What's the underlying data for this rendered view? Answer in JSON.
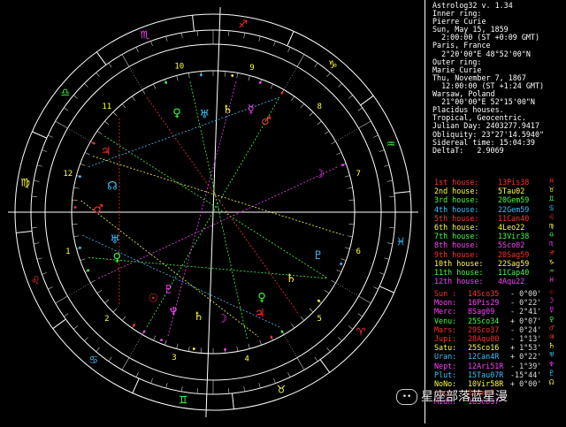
{
  "info_lines": [
    "Astrolog32 v. 1.34",
    "Inner ring:",
    "Pierre Curie",
    "Sun, May 15, 1859",
    "  2:00:00 (ST +0:09 GMT)",
    "Paris, France",
    "  2°20'00\"E 48°52'00\"N",
    "Outer ring:",
    "Marie Curie",
    "Thu, November 7, 1867",
    "  12:00:00 (ST +1:24 GMT)",
    "Warsaw, Poland",
    "  21°00'00\"E 52°15'00\"N",
    "Placidus houses.",
    "Tropical, Geocentric.",
    "Julian Day: 2403277.9417",
    "Obliquity: 23°27'14.5940\"",
    "Sidereal time: 15:04:39",
    "DeltaT:   2.9069"
  ],
  "houses": [
    {
      "label": "1st house:",
      "value": "13Pis38",
      "color": "#ff3030",
      "symbol": "♓"
    },
    {
      "label": "2nd house:",
      "value": "5Tau02",
      "color": "#ffff40",
      "symbol": "♉"
    },
    {
      "label": "3rd house:",
      "value": "20Gem59",
      "color": "#40ff40",
      "symbol": "♊"
    },
    {
      "label": "4th house:",
      "value": "22Gem59",
      "color": "#40c0ff",
      "symbol": "♋"
    },
    {
      "label": "5th house:",
      "value": "11Can40",
      "color": "#ff3030",
      "symbol": "♌"
    },
    {
      "label": "6th house:",
      "value": "4Leo22",
      "color": "#ffff40",
      "symbol": "♍"
    },
    {
      "label": "7th house:",
      "value": "13Vir38",
      "color": "#40ff40",
      "symbol": "♎"
    },
    {
      "label": "8th house:",
      "value": "5Sco02",
      "color": "#ff40ff",
      "symbol": "♏"
    },
    {
      "label": "9th house:",
      "value": "20Sag59",
      "color": "#ff3030",
      "symbol": "♐"
    },
    {
      "label": "10th house:",
      "value": "22Sag59",
      "color": "#ffff40",
      "symbol": "♑"
    },
    {
      "label": "11th house:",
      "value": "11Cap40",
      "color": "#40ff40",
      "symbol": "♒"
    },
    {
      "label": "12th house:",
      "value": "4Aqu22",
      "color": "#ff40ff",
      "symbol": "♓"
    }
  ],
  "planets": [
    {
      "name": "Sun :",
      "value": "14Sco35",
      "lat": "- 0°00'",
      "color": "#ff3030",
      "symbol": "☉"
    },
    {
      "name": "Moon:",
      "value": "16Pis29",
      "lat": "- 0°22'",
      "color": "#ff40ff",
      "symbol": "☽"
    },
    {
      "name": "Merc:",
      "value": "8Sag09",
      "lat": "- 2°41'",
      "color": "#ff40ff",
      "symbol": "☿"
    },
    {
      "name": "Venu:",
      "value": "25Sco34",
      "lat": "+ 0°07'",
      "color": "#40ff40",
      "symbol": "♀"
    },
    {
      "name": "Mars:",
      "value": "29Sco37",
      "lat": "- 0°24'",
      "color": "#ff3030",
      "symbol": "♂"
    },
    {
      "name": "Jupi:",
      "value": "28Aqu00",
      "lat": "- 1°13'",
      "color": "#ff3030",
      "symbol": "♃"
    },
    {
      "name": "Satu:",
      "value": "25Sco16",
      "lat": "+ 1°53'",
      "color": "#ffff40",
      "symbol": "♄"
    },
    {
      "name": "Uran:",
      "value": "12Can4R",
      "lat": "+ 0°22'",
      "color": "#40c0ff",
      "symbol": "♅"
    },
    {
      "name": "Nept:",
      "value": "12Ari51R",
      "lat": "- 1°39'",
      "color": "#ff40ff",
      "symbol": "♆"
    },
    {
      "name": "Plut:",
      "value": "15Tau07R",
      "lat": "-15°44'",
      "color": "#40c0ff",
      "symbol": "♇"
    },
    {
      "name": "NoNo:",
      "value": "10Vir58R",
      "lat": "+ 0°00'",
      "color": "#ffff40",
      "symbol": "☊"
    },
    {
      "name": "Asce:",
      "value": "20Gem3",
      "lat": "",
      "color": "#ff3030",
      "symbol": ""
    },
    {
      "name": "Midh:",
      "value": "18Sco37",
      "lat": "",
      "color": "#ff40ff",
      "symbol": ""
    }
  ],
  "chart": {
    "house_numbers": [
      "1",
      "2",
      "3",
      "4",
      "5",
      "6",
      "7",
      "8",
      "9",
      "10",
      "11",
      "12"
    ],
    "zodiac": [
      {
        "glyph": "♐",
        "name": "sagittarius",
        "color": "#ff3030"
      },
      {
        "glyph": "♑",
        "name": "capricorn",
        "color": "#ffff40"
      },
      {
        "glyph": "♒",
        "name": "aquarius",
        "color": "#40ff40"
      },
      {
        "glyph": "♓",
        "name": "pisces",
        "color": "#40c0ff"
      },
      {
        "glyph": "♈",
        "name": "aries",
        "color": "#ff3030"
      },
      {
        "glyph": "♉",
        "name": "taurus",
        "color": "#ffff40"
      },
      {
        "glyph": "♊",
        "name": "gemini",
        "color": "#40ff40"
      },
      {
        "glyph": "♋",
        "name": "cancer",
        "color": "#40c0ff"
      },
      {
        "glyph": "♌",
        "name": "leo",
        "color": "#ff3030"
      },
      {
        "glyph": "♍",
        "name": "virgo",
        "color": "#ffff40"
      },
      {
        "glyph": "♎",
        "name": "libra",
        "color": "#40ff40"
      },
      {
        "glyph": "♏",
        "name": "scorpio",
        "color": "#ff40ff"
      }
    ],
    "colors": {
      "ring": "#ffffff",
      "tick": "#cccccc",
      "background": "#000000"
    }
  },
  "watermark": "星座部落蓝星漫",
  "watermark_icon": "wechat-icon"
}
